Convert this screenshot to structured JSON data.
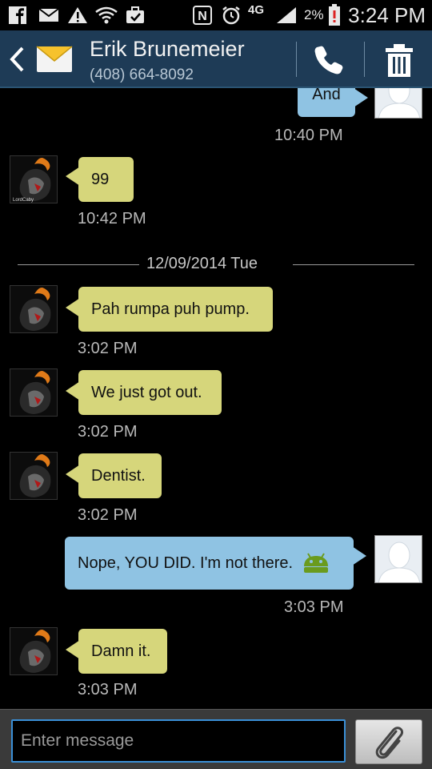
{
  "status_bar": {
    "battery_percent": "2%",
    "time": "3:24 PM",
    "network": "4G",
    "icons": [
      "facebook-icon",
      "mail-icon",
      "warning-icon",
      "wifi-icon",
      "briefcase-icon",
      "nfc-icon",
      "alarm-icon",
      "signal-icon",
      "battery-icon"
    ]
  },
  "header": {
    "contact_name": "Erik Brunemeier",
    "contact_phone": "(408) 664-8092",
    "accent_color": "#1e3b56"
  },
  "messages": [
    {
      "direction": "out",
      "text": "And",
      "time": "10:40 PM"
    },
    {
      "direction": "in",
      "text": "99",
      "time": "10:42 PM"
    },
    {
      "direction": "in",
      "text": "Pah rumpa puh pump.",
      "time": "3:02 PM"
    },
    {
      "direction": "in",
      "text": "We just got out.",
      "time": "3:02 PM"
    },
    {
      "direction": "in",
      "text": "Dentist.",
      "time": "3:02 PM"
    },
    {
      "direction": "out",
      "text": "Nope, YOU DID.  I'm not there.",
      "time": "3:03 PM",
      "emoji": "android-icon"
    },
    {
      "direction": "in",
      "text": "Damn it.",
      "time": "3:03 PM"
    }
  ],
  "date_separator": "12/09/2014 Tue",
  "avatar_caption": "LordCaby",
  "composer": {
    "placeholder": "Enter message"
  },
  "colors": {
    "incoming_bubble": "#d6d67b",
    "outgoing_bubble": "#8fc3e3",
    "input_focus": "#3a8fd6"
  }
}
